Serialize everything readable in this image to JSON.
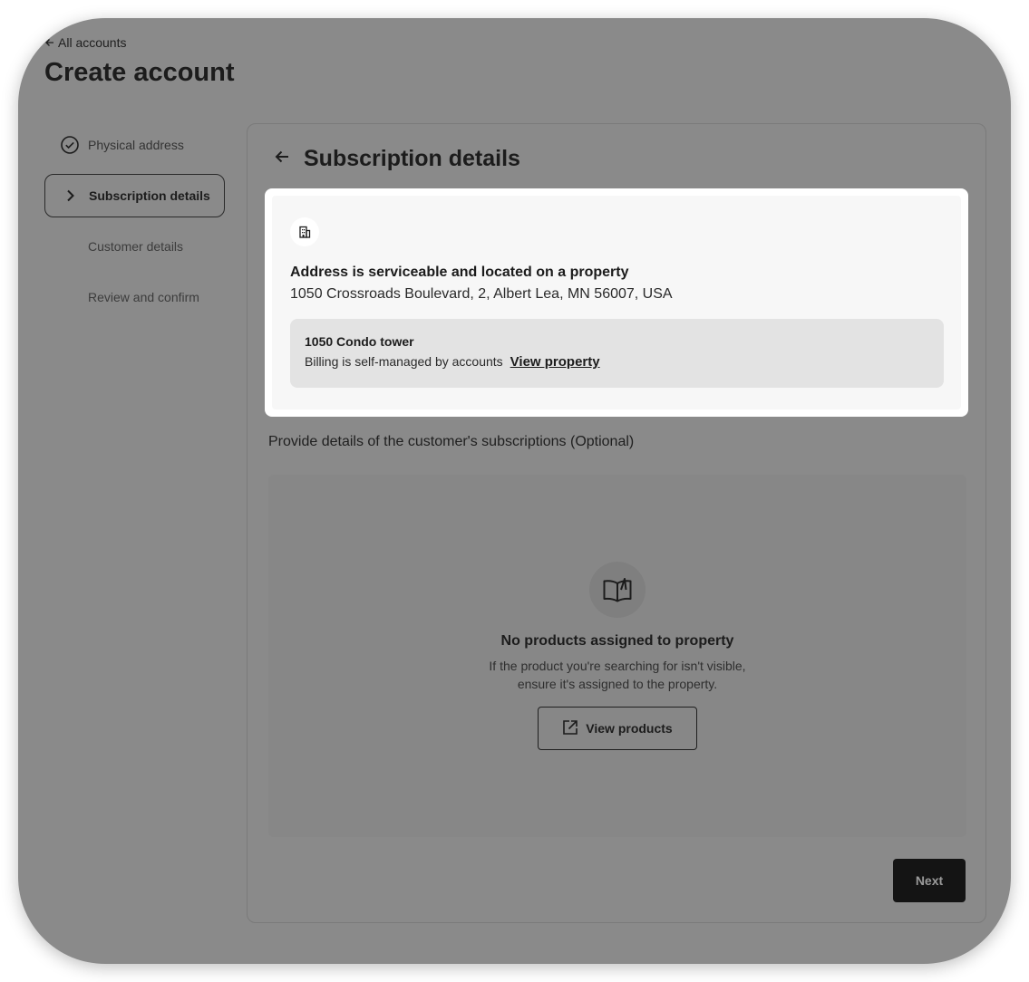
{
  "header": {
    "back_link": "All accounts",
    "title": "Create account"
  },
  "steps": [
    {
      "label": "Physical address",
      "status": "complete",
      "icon": "check-circle-icon"
    },
    {
      "label": "Subscription details",
      "status": "active",
      "icon": "chevron-right-icon"
    },
    {
      "label": "Customer details",
      "status": "pending"
    },
    {
      "label": "Review and confirm",
      "status": "pending"
    }
  ],
  "panel": {
    "title": "Subscription details",
    "back_icon": "arrow-left-icon"
  },
  "address_card": {
    "icon": "building-icon",
    "heading": "Address is serviceable and located on a property",
    "address": "1050 Crossroads Boulevard, 2, Albert Lea, MN 56007, USA",
    "property": {
      "name": "1050 Condo tower",
      "billing": "Billing is self-managed by accounts",
      "link": "View property"
    }
  },
  "subscriptions": {
    "prompt": "Provide details of the customer's subscriptions (Optional)",
    "empty": {
      "icon": "open-book-icon",
      "title": "No products assigned to property",
      "line1": "If the product you're searching for isn't visible,",
      "line2": "ensure it's assigned to the property.",
      "button": "View products",
      "button_icon": "external-link-icon"
    }
  },
  "footer": {
    "next": "Next"
  },
  "colors": {
    "overlay": "#8a8a8a",
    "card": "#ffffff",
    "primary_button": "#141414"
  }
}
